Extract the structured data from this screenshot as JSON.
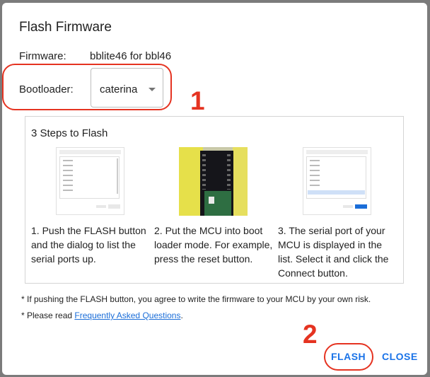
{
  "dialog": {
    "title": "Flash Firmware",
    "firmware_label": "Firmware:",
    "firmware_value": "bblite46 for bbl46",
    "bootloader_label": "Bootloader:",
    "bootloader_value": "caterina",
    "steps_title": "3 Steps to Flash",
    "steps": [
      {
        "caption_lines": [
          "1. Push the FLASH button",
          "and the dialog to list the",
          "serial ports up."
        ]
      },
      {
        "caption_lines": [
          "2. Put the MCU into boot",
          "loader mode. For example,",
          "press the reset button."
        ]
      },
      {
        "caption_lines": [
          "3. The serial port of your",
          "MCU is displayed in the",
          "list. Select it and click the",
          "Connect button."
        ]
      }
    ],
    "note1": "* If pushing the FLASH button, you agree to write the firmware to your MCU by your own risk.",
    "note2_prefix": "* Please read ",
    "note2_link": "Frequently Asked Questions",
    "note2_suffix": ".",
    "flash_button": "FLASH",
    "close_button": "CLOSE"
  },
  "annotations": {
    "one": "1",
    "two": "2",
    "color": "#e53321"
  },
  "colors": {
    "accent": "#1a73e8",
    "backdrop": "#7b7b7b"
  }
}
